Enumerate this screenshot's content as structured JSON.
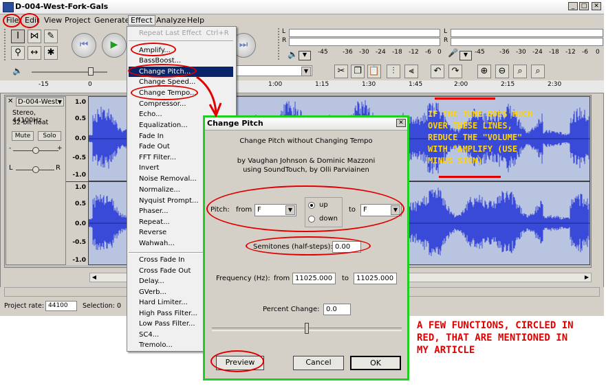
{
  "window": {
    "title": "D-004-West-Fork-Gals",
    "controls": [
      "_",
      "□",
      "✕"
    ]
  },
  "menubar": {
    "items": [
      "File",
      "Edit",
      "View",
      "Project",
      "Generate",
      "Effect",
      "Analyze",
      "Help"
    ],
    "open_item": "Effect"
  },
  "meter": {
    "lr_labels": [
      "L",
      "R",
      "L",
      "R"
    ],
    "play_ticks": [
      "-45",
      "-36",
      "-30",
      "-24",
      "-18",
      "-12",
      "-6",
      "0"
    ],
    "rec_ticks": [
      "-45",
      "-36",
      "-30",
      "-24",
      "-18",
      "-12",
      "-6",
      "0"
    ]
  },
  "ruler": {
    "ticks": [
      "-15",
      "0",
      "1:00",
      "1:15",
      "1:30",
      "1:45",
      "2:00",
      "2:15",
      "2:30"
    ]
  },
  "track": {
    "name": "D-004-West",
    "info": [
      "Stereo, 44100Hz",
      "32-bit float"
    ],
    "mute": "Mute",
    "solo": "Solo",
    "gain_label_left": "L",
    "gain_label_right": "R",
    "scale_top": [
      "1.0",
      "0.5",
      "0.0",
      "-0.5",
      "-1.0"
    ],
    "scale_bottom": [
      "1.0",
      "0.5",
      "0.0",
      "-0.5",
      "-1.0"
    ]
  },
  "status": {
    "project_rate_label": "Project rate:",
    "project_rate_value": "44100",
    "selection_label": "Selection: 0"
  },
  "effect_menu": {
    "items": [
      {
        "label": "Repeat Last Effect",
        "shortcut": "Ctrl+R",
        "disabled": true
      },
      {
        "label": "Amplify..."
      },
      {
        "label": "BassBoost..."
      },
      {
        "label": "Change Pitch...",
        "highlight": true
      },
      {
        "label": "Change Speed..."
      },
      {
        "label": "Change Tempo..."
      },
      {
        "label": "Compressor..."
      },
      {
        "label": "Echo..."
      },
      {
        "label": "Equalization..."
      },
      {
        "label": "Fade In"
      },
      {
        "label": "Fade Out"
      },
      {
        "label": "FFT Filter..."
      },
      {
        "label": "Invert"
      },
      {
        "label": "Noise Removal..."
      },
      {
        "label": "Normalize..."
      },
      {
        "label": "Nyquist Prompt..."
      },
      {
        "label": "Phaser..."
      },
      {
        "label": "Repeat..."
      },
      {
        "label": "Reverse"
      },
      {
        "label": "Wahwah..."
      },
      {
        "label": "Cross Fade In"
      },
      {
        "label": "Cross Fade Out"
      },
      {
        "label": "Delay..."
      },
      {
        "label": "GVerb..."
      },
      {
        "label": "Hard Limiter..."
      },
      {
        "label": "High Pass Filter..."
      },
      {
        "label": "Low Pass Filter..."
      },
      {
        "label": "SC4..."
      },
      {
        "label": "Tremolo..."
      }
    ]
  },
  "dialog": {
    "title": "Change Pitch",
    "heading": "Change Pitch without Changing Tempo",
    "credit_line1": "by Vaughan Johnson & Dominic Mazzoni",
    "credit_line2": "using SoundTouch, by Olli Parviainen",
    "pitch_label": "Pitch:",
    "from_label": "from",
    "from_value": "F",
    "up_label": "up",
    "down_label": "down",
    "to_label": "to",
    "to_value": "F",
    "semitones_label": "Semitones (half-steps):",
    "semitones_value": "0.00",
    "freq_label": "Frequency (Hz):",
    "freq_from_label": "from",
    "freq_from_value": "11025.000",
    "freq_to_label": "to",
    "freq_to_value": "11025.000",
    "percent_label": "Percent Change:",
    "percent_value": "0.0",
    "percent_slider": 0.5,
    "preview": "Preview",
    "cancel": "Cancel",
    "ok": "OK"
  },
  "annotations": {
    "yellow": "IF THE TUNE GOES MUCH\nOVER THESE LINES,\nREDUCE THE \"VOLUME\"\nWITH \"AMPLIFY (USE\nMINUS SIGN)",
    "red": "A FEW FUNCTIONS, CIRCLED IN\nRED, THAT ARE MENTIONED IN\nMY ARTICLE"
  },
  "colors": {
    "waveform": "#3a4ad8",
    "annotation_red": "#e00000",
    "annotation_yellow": "#ffd400",
    "dialog_border": "#20d020",
    "menu_highlight": "#0a246a"
  }
}
